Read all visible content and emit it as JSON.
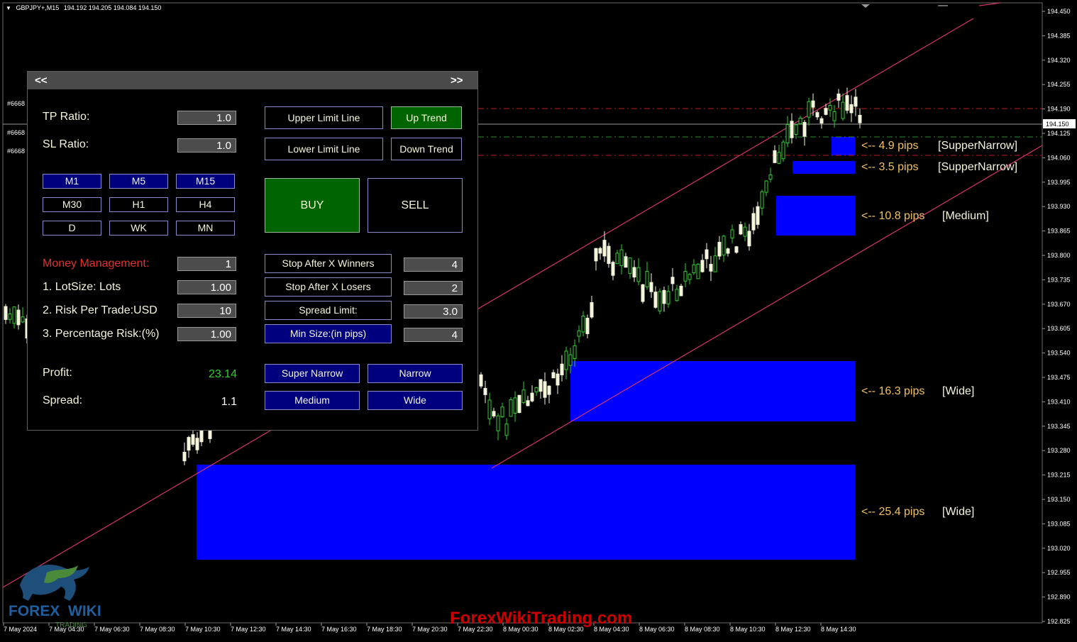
{
  "symbol": {
    "name": "GBPJPY+,M15",
    "ohlc": "194.192 194.205 194.084 194.150"
  },
  "colors": {
    "bg": "#000000",
    "bull": "#32cd32",
    "bear": "#f5f5dc",
    "zone": "#0000ff",
    "channel": "#d6336c",
    "axis_text": "#ffffff"
  },
  "price_axis": {
    "labels": [
      "194.450",
      "194.385",
      "194.320",
      "194.255",
      "194.190",
      "194.125",
      "194.060",
      "193.995",
      "193.930",
      "193.865",
      "193.800",
      "193.735",
      "193.670",
      "193.605",
      "193.540",
      "193.475",
      "193.410",
      "193.345",
      "193.280",
      "193.215",
      "193.150",
      "193.085",
      "193.020",
      "192.955",
      "192.890",
      "192.825"
    ],
    "current": "194.150"
  },
  "time_axis": [
    "7 May 2024",
    "7 May 04:30",
    "7 May 06:30",
    "7 May 08:30",
    "7 May 10:30",
    "7 May 12:30",
    "7 May 14:30",
    "7 May 16:30",
    "7 May 18:30",
    "7 May 20:30",
    "7 May 22:30",
    "8 May 00:30",
    "8 May 02:30",
    "8 May 04:30",
    "8 May 06:30",
    "8 May 08:30",
    "8 May 10:30",
    "8 May 12:30",
    "8 May 14:30"
  ],
  "line_tags": [
    "#6668",
    "#6668",
    "#6668"
  ],
  "panel": {
    "nav_left": "<<",
    "nav_right": ">>",
    "tp_ratio_label": "TP Ratio:",
    "tp_ratio_value": "1.0",
    "sl_ratio_label": "SL Ratio:",
    "sl_ratio_value": "1.0",
    "upper_limit_line": "Upper Limit Line",
    "lower_limit_line": "Lower Limit Line",
    "up_trend": "Up Trend",
    "down_trend": "Down Trend",
    "timeframes": [
      "M1",
      "M5",
      "M15",
      "M30",
      "H1",
      "H4",
      "D",
      "WK",
      "MN"
    ],
    "buy": "BUY",
    "sell": "SELL",
    "money_management_label": "Money Management:",
    "money_management_value": "1",
    "lotsize_label": "1. LotSize: Lots",
    "lotsize_value": "1.00",
    "risk_label": "2. Risk Per Trade:USD",
    "risk_value": "10",
    "pct_label": "3. Percentage Risk:(%)",
    "pct_value": "1.00",
    "stop_winners": "Stop After X Winners",
    "stop_winners_value": "4",
    "stop_losers": "Stop After X Losers",
    "stop_losers_value": "2",
    "spread_limit": "Spread Limit:",
    "spread_limit_value": "3.0",
    "min_size": "Min Size:(in pips)",
    "min_size_value": "4",
    "profit_label": "Profit:",
    "profit_value": "23.14",
    "spread_label": "Spread:",
    "spread_value": "1.1",
    "super_narrow": "Super Narrow",
    "narrow": "Narrow",
    "medium": "Medium",
    "wide": "Wide"
  },
  "zones": [
    {
      "pips": "<-- 4.9 pips",
      "tag": "[SupperNarrow]"
    },
    {
      "pips": "<-- 3.5 pips",
      "tag": "[SupperNarrow]"
    },
    {
      "pips": "<-- 10.8 pips",
      "tag": "[Medium]"
    },
    {
      "pips": "<-- 16.3 pips",
      "tag": "[Wide]"
    },
    {
      "pips": "<-- 25.4 pips",
      "tag": "[Wide]"
    }
  ],
  "logo": {
    "text1": "FOREX",
    "text2": "WIKI",
    "sub": "TRADING"
  },
  "watermark": "ForexWikiTrading.com"
}
